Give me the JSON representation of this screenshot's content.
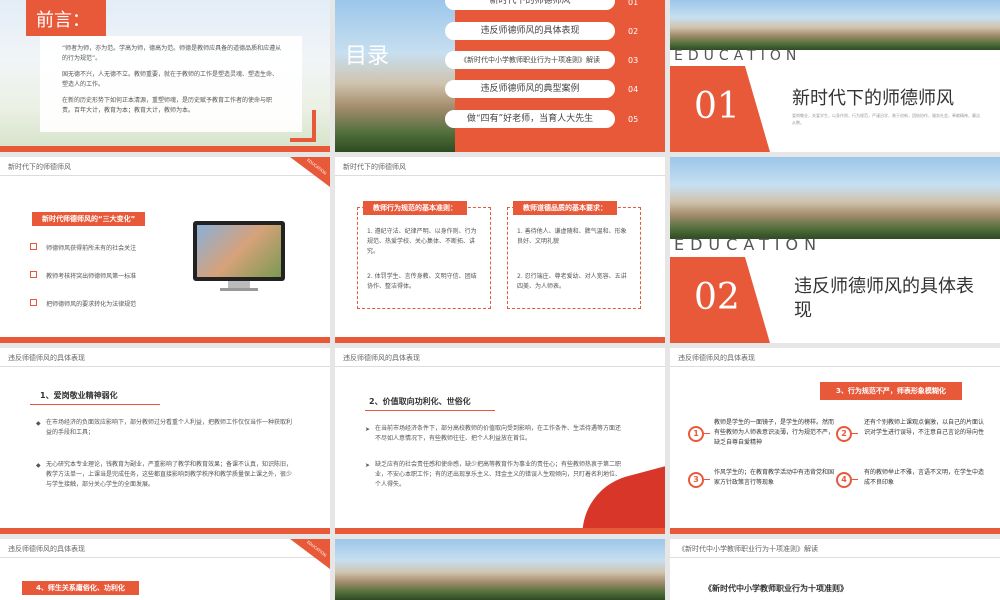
{
  "s1": {
    "title": "前言：",
    "p1": "“师者为师，亦为范。学高为师，德高为范。师德是教师应具备的道德品质和应遵从的行为规范”。",
    "p2": "国无德不兴，人无德不立。教师重要，就在于教师的工作是塑造灵魂、塑造生命、塑造人的工作。",
    "p3": "在新的历史形势下如何正本清源，重塑师魂，是历史赋予教育工作者的使命与职责。百年大计，教育为本；教育大计，教师为本。"
  },
  "s2": {
    "title": "目录",
    "items": [
      {
        "label": "新时代下的师德师风",
        "num": "01"
      },
      {
        "label": "违反师德师风的具体表现",
        "num": "02"
      },
      {
        "label": "《新时代中小学教师职业行为十项准则》解读",
        "num": "03"
      },
      {
        "label": "违反师德师风的典型案例",
        "num": "04"
      },
      {
        "label": "做“四有”好老师，当育人大先生",
        "num": "05"
      }
    ]
  },
  "s3": {
    "edu": "EDUCATION",
    "num": "01",
    "title": "新时代下的师德师风",
    "sub": "爱岗敬业，关爱学生，以身作则，行为规范，严谨治学，勇于创新，团结协作，服务社会，奉献精神，廉洁从教。"
  },
  "s4": {
    "header": "新时代下的师德师风",
    "corner": "EDUCATION",
    "tag": "新时代师德师风的“三大变化”",
    "items": [
      "师德师风获得前所未有的社会关注",
      "教师考核将突出师德师风第一标准",
      "把师德师风的要求转化为法律规范"
    ]
  },
  "s5": {
    "header": "新时代下的师德师风",
    "box1": {
      "title": "教师行为规范的基本准则：",
      "items": [
        "1. 遵纪守法、纪律严明、以身作则、行为规范、热爱学校、关心集体、不断拓、讲究。",
        "2. 体罚学生、言传身教、文明守信、团结协作、整洁得体。"
      ]
    },
    "box2": {
      "title": "教师道德品质的基本要求：",
      "items": [
        "1. 善待他人、谦虚随和、脾气温和、形象良好、文明礼貌",
        "2. 忍行端庄、尊老爱幼、对人宽容、五讲四美、为人师表。"
      ]
    }
  },
  "s6": {
    "edu": "EDUCATION",
    "num": "02",
    "title": "违反师德师风的具体表现"
  },
  "s7": {
    "header": "违反师德师风的具体表现",
    "heading": "1、爱岗敬业精神弱化",
    "p1": "在市场经济的负面效应影响下，部分教师过分看重个人利益，把教师工作仅仅当作一种获取利益的手段和工具；",
    "p2": "无心研究本专业理论，钱教育为副业，严重影响了教学和教育效果；备课不认真，知识陈旧，教学方法单一，上课当是完成任务，这些都直接影响到教学秩序和教学质量保上课之外，很少与学生接触，部分关心学生的全面发展。"
  },
  "s8": {
    "header": "违反师德师风的具体表现",
    "heading": "2、价值取向功利化、世俗化",
    "p1": "在当前市场经济条件下，部分高校教师的价值取向受到影响，在工作条件、生活待遇等方面还不尽如人意情况下，有些教师往往、把个人利益放在首位。",
    "p2": "缺乏应有的社会责任感和使命感，缺少把高等教育作为事业的责任心；有些教师热衷于第二职业，不安心本职工作；有的还出现享乐主义、拜金主义的错误人生观倾向，只盯着名利地位、个人得失。"
  },
  "s9": {
    "header": "违反师德师风的具体表现",
    "tag": "3、行为规范不严，师表形象模糊化",
    "items": [
      {
        "num": "1",
        "text": "教师是学生的一面镜子，是学生的榜样。然而有些教师为人师表意识淡薄，行为规范不严，缺乏自尊自爱精神"
      },
      {
        "num": "2",
        "text": "还有个别教师上课观点偏激，以自己的片面认识对学生进行误导，不注意自己言论的导向性"
      },
      {
        "num": "3",
        "text": "作风学生的；在教育教学活动中有违背党和国家方针政策言行等现象"
      },
      {
        "num": "4",
        "text": "有的教师举止不雅，言语不文明，在学生中造成不良印象"
      }
    ]
  },
  "s10": {
    "header": "违反师德师风的具体表现",
    "corner": "EDUCATION",
    "tag": "4、师生关系庸俗化、功利化"
  },
  "s12": {
    "header": "《新时代中小学教师职业行为十项准则》解读",
    "heading": "《新时代中小学教师职业行为十项准则》"
  }
}
